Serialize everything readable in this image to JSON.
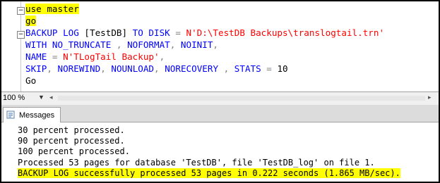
{
  "editor": {
    "lines": [
      {
        "text": "use master",
        "highlight": true
      },
      {
        "text": "go",
        "highlight": true
      },
      {
        "parts": [
          {
            "t": "BACKUP LOG ",
            "c": "kw"
          },
          {
            "t": "[TestDB]",
            "c": "id"
          },
          {
            "t": " TO DISK ",
            "c": "kw"
          },
          {
            "t": "= ",
            "c": "gray"
          },
          {
            "t": "N'D:\\TestDB Backups\\translogtail.trn'",
            "c": "str"
          }
        ]
      },
      {
        "parts": [
          {
            "t": "WITH NO_TRUNCATE ",
            "c": "kw"
          },
          {
            "t": ", ",
            "c": "gray"
          },
          {
            "t": "NOFORMAT",
            "c": "kw"
          },
          {
            "t": ", ",
            "c": "gray"
          },
          {
            "t": "NOINIT",
            "c": "kw"
          },
          {
            "t": ",",
            "c": "gray"
          }
        ]
      },
      {
        "parts": [
          {
            "t": "NAME ",
            "c": "kw"
          },
          {
            "t": "= ",
            "c": "gray"
          },
          {
            "t": "N'TLogTail Backup'",
            "c": "str"
          },
          {
            "t": ",",
            "c": "gray"
          }
        ]
      },
      {
        "parts": [
          {
            "t": "SKIP",
            "c": "kw"
          },
          {
            "t": ", ",
            "c": "gray"
          },
          {
            "t": "NOREWIND",
            "c": "kw"
          },
          {
            "t": ", ",
            "c": "gray"
          },
          {
            "t": "NOUNLOAD",
            "c": "kw"
          },
          {
            "t": ", ",
            "c": "gray"
          },
          {
            "t": "NORECOVERY ",
            "c": "kw"
          },
          {
            "t": ", ",
            "c": "gray"
          },
          {
            "t": "STATS ",
            "c": "kw"
          },
          {
            "t": "= ",
            "c": "gray"
          },
          {
            "t": "10",
            "c": "num"
          }
        ]
      },
      {
        "parts": [
          {
            "t": "Go",
            "c": "plain"
          }
        ]
      }
    ],
    "collapse_glyph": "−"
  },
  "zoombar": {
    "zoom": "100 %",
    "dropdown_glyph": "▼",
    "left_arrow": "◂",
    "right_arrow": "▸"
  },
  "results": {
    "tab_label": "Messages",
    "tab_icon": "messages-icon",
    "messages": [
      {
        "text": "30 percent processed.",
        "highlight": false
      },
      {
        "text": "90 percent processed.",
        "highlight": false
      },
      {
        "text": "100 percent processed.",
        "highlight": false
      },
      {
        "text": "Processed 53 pages for database 'TestDB', file 'TestDB_log' on file 1.",
        "highlight": false
      },
      {
        "text": "BACKUP LOG successfully processed 53 pages in 0.222 seconds (1.865 MB/sec).",
        "highlight": true
      }
    ]
  },
  "colors": {
    "keyword": "#0000ff",
    "string": "#ff0000",
    "operator": "#808080",
    "highlight": "#ffff00"
  }
}
